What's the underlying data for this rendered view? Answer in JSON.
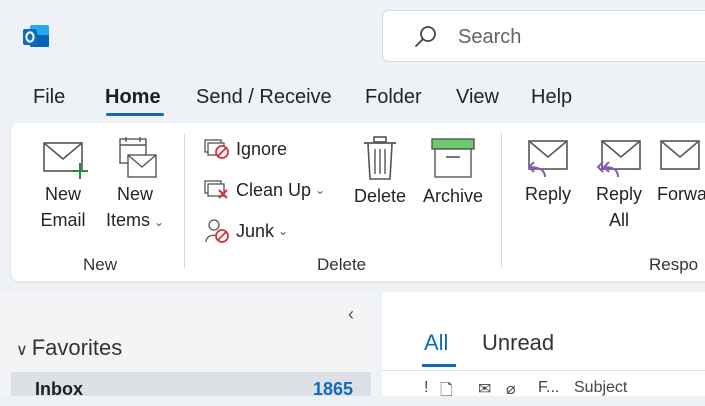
{
  "app": {
    "logo_icon": "outlook-logo-icon",
    "accent": "#0f6cbd"
  },
  "search": {
    "label": "Search"
  },
  "menu": {
    "tabs": [
      "File",
      "Home",
      "Send / Receive",
      "Folder",
      "View",
      "Help"
    ],
    "active": "Home"
  },
  "ribbon": {
    "new_group": {
      "label": "New",
      "new_email": [
        "New",
        "Email"
      ],
      "new_items": [
        "New",
        "Items"
      ]
    },
    "delete_group": {
      "label": "Delete",
      "ignore": "Ignore",
      "clean_up": "Clean Up",
      "junk": "Junk",
      "delete": "Delete",
      "archive": "Archive"
    },
    "respond_group": {
      "label": "Respo",
      "reply": "Reply",
      "reply_all": [
        "Reply",
        "All"
      ],
      "forward": "Forwa"
    }
  },
  "folders": {
    "collapse_glyph": "‹",
    "favorites_label": "Favorites",
    "inbox_label": "Inbox",
    "inbox_count": "1865"
  },
  "mail_list": {
    "tabs": [
      "All",
      "Unread"
    ],
    "active_tab": "All",
    "columns": {
      "importance": "!",
      "subject": "Subject",
      "from_short": "F..."
    }
  }
}
